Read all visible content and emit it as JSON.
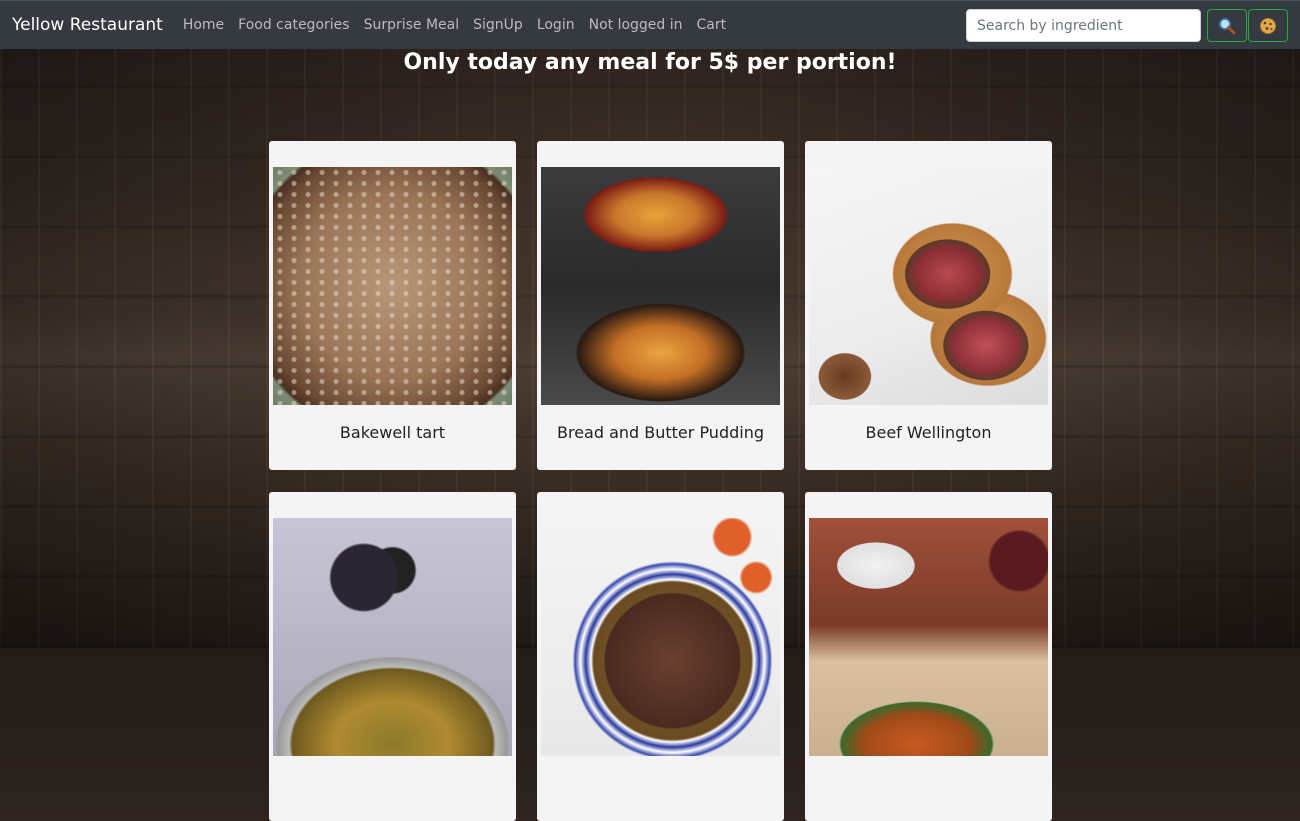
{
  "navbar": {
    "brand": "Yellow Restaurant",
    "links": [
      "Home",
      "Food categories",
      "Surprise Meal",
      "SignUp",
      "Login",
      "Not logged in",
      "Cart"
    ],
    "search_placeholder": "Search by ingredient",
    "search_button_icon": "magnifier-icon",
    "cookie_button_icon": "cookie-icon",
    "button_border_color": "#28a745"
  },
  "promo": {
    "text": "Only today any meal for 5$ per portion!"
  },
  "meals": [
    {
      "name": "Bakewell tart",
      "image": "bakewell-tart-image"
    },
    {
      "name": "Bread and Butter Pudding",
      "image": "bread-butter-pudding-image"
    },
    {
      "name": "Beef Wellington",
      "image": "beef-wellington-image"
    },
    {
      "name": "",
      "image": "curry-dish-image"
    },
    {
      "name": "",
      "image": "beef-brisket-image"
    },
    {
      "name": "",
      "image": "roast-dinner-image"
    }
  ],
  "colors": {
    "navbar_bg": "#343a40",
    "card_bg": "#f4f4f4",
    "promo_text": "#ffffff"
  }
}
